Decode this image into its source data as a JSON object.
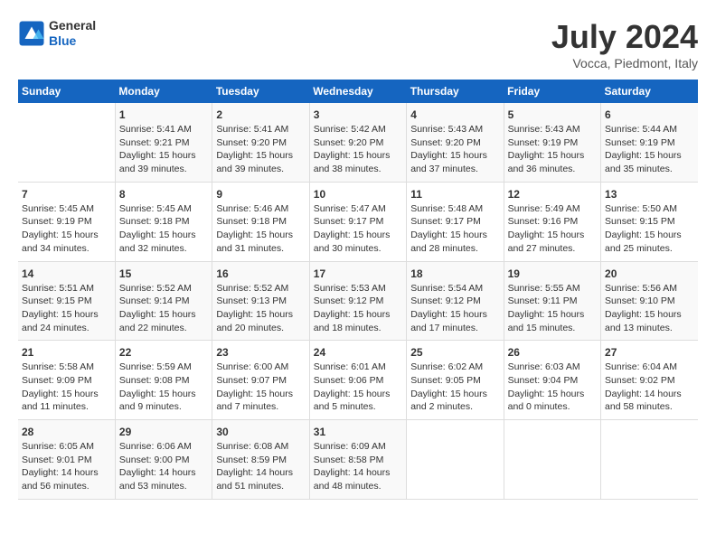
{
  "header": {
    "logo_general": "General",
    "logo_blue": "Blue",
    "month_year": "July 2024",
    "location": "Vocca, Piedmont, Italy"
  },
  "columns": [
    "Sunday",
    "Monday",
    "Tuesday",
    "Wednesday",
    "Thursday",
    "Friday",
    "Saturday"
  ],
  "weeks": [
    [
      {
        "day": "",
        "info": ""
      },
      {
        "day": "1",
        "info": "Sunrise: 5:41 AM\nSunset: 9:21 PM\nDaylight: 15 hours\nand 39 minutes."
      },
      {
        "day": "2",
        "info": "Sunrise: 5:41 AM\nSunset: 9:20 PM\nDaylight: 15 hours\nand 39 minutes."
      },
      {
        "day": "3",
        "info": "Sunrise: 5:42 AM\nSunset: 9:20 PM\nDaylight: 15 hours\nand 38 minutes."
      },
      {
        "day": "4",
        "info": "Sunrise: 5:43 AM\nSunset: 9:20 PM\nDaylight: 15 hours\nand 37 minutes."
      },
      {
        "day": "5",
        "info": "Sunrise: 5:43 AM\nSunset: 9:19 PM\nDaylight: 15 hours\nand 36 minutes."
      },
      {
        "day": "6",
        "info": "Sunrise: 5:44 AM\nSunset: 9:19 PM\nDaylight: 15 hours\nand 35 minutes."
      }
    ],
    [
      {
        "day": "7",
        "info": "Sunrise: 5:45 AM\nSunset: 9:19 PM\nDaylight: 15 hours\nand 34 minutes."
      },
      {
        "day": "8",
        "info": "Sunrise: 5:45 AM\nSunset: 9:18 PM\nDaylight: 15 hours\nand 32 minutes."
      },
      {
        "day": "9",
        "info": "Sunrise: 5:46 AM\nSunset: 9:18 PM\nDaylight: 15 hours\nand 31 minutes."
      },
      {
        "day": "10",
        "info": "Sunrise: 5:47 AM\nSunset: 9:17 PM\nDaylight: 15 hours\nand 30 minutes."
      },
      {
        "day": "11",
        "info": "Sunrise: 5:48 AM\nSunset: 9:17 PM\nDaylight: 15 hours\nand 28 minutes."
      },
      {
        "day": "12",
        "info": "Sunrise: 5:49 AM\nSunset: 9:16 PM\nDaylight: 15 hours\nand 27 minutes."
      },
      {
        "day": "13",
        "info": "Sunrise: 5:50 AM\nSunset: 9:15 PM\nDaylight: 15 hours\nand 25 minutes."
      }
    ],
    [
      {
        "day": "14",
        "info": "Sunrise: 5:51 AM\nSunset: 9:15 PM\nDaylight: 15 hours\nand 24 minutes."
      },
      {
        "day": "15",
        "info": "Sunrise: 5:52 AM\nSunset: 9:14 PM\nDaylight: 15 hours\nand 22 minutes."
      },
      {
        "day": "16",
        "info": "Sunrise: 5:52 AM\nSunset: 9:13 PM\nDaylight: 15 hours\nand 20 minutes."
      },
      {
        "day": "17",
        "info": "Sunrise: 5:53 AM\nSunset: 9:12 PM\nDaylight: 15 hours\nand 18 minutes."
      },
      {
        "day": "18",
        "info": "Sunrise: 5:54 AM\nSunset: 9:12 PM\nDaylight: 15 hours\nand 17 minutes."
      },
      {
        "day": "19",
        "info": "Sunrise: 5:55 AM\nSunset: 9:11 PM\nDaylight: 15 hours\nand 15 minutes."
      },
      {
        "day": "20",
        "info": "Sunrise: 5:56 AM\nSunset: 9:10 PM\nDaylight: 15 hours\nand 13 minutes."
      }
    ],
    [
      {
        "day": "21",
        "info": "Sunrise: 5:58 AM\nSunset: 9:09 PM\nDaylight: 15 hours\nand 11 minutes."
      },
      {
        "day": "22",
        "info": "Sunrise: 5:59 AM\nSunset: 9:08 PM\nDaylight: 15 hours\nand 9 minutes."
      },
      {
        "day": "23",
        "info": "Sunrise: 6:00 AM\nSunset: 9:07 PM\nDaylight: 15 hours\nand 7 minutes."
      },
      {
        "day": "24",
        "info": "Sunrise: 6:01 AM\nSunset: 9:06 PM\nDaylight: 15 hours\nand 5 minutes."
      },
      {
        "day": "25",
        "info": "Sunrise: 6:02 AM\nSunset: 9:05 PM\nDaylight: 15 hours\nand 2 minutes."
      },
      {
        "day": "26",
        "info": "Sunrise: 6:03 AM\nSunset: 9:04 PM\nDaylight: 15 hours\nand 0 minutes."
      },
      {
        "day": "27",
        "info": "Sunrise: 6:04 AM\nSunset: 9:02 PM\nDaylight: 14 hours\nand 58 minutes."
      }
    ],
    [
      {
        "day": "28",
        "info": "Sunrise: 6:05 AM\nSunset: 9:01 PM\nDaylight: 14 hours\nand 56 minutes."
      },
      {
        "day": "29",
        "info": "Sunrise: 6:06 AM\nSunset: 9:00 PM\nDaylight: 14 hours\nand 53 minutes."
      },
      {
        "day": "30",
        "info": "Sunrise: 6:08 AM\nSunset: 8:59 PM\nDaylight: 14 hours\nand 51 minutes."
      },
      {
        "day": "31",
        "info": "Sunrise: 6:09 AM\nSunset: 8:58 PM\nDaylight: 14 hours\nand 48 minutes."
      },
      {
        "day": "",
        "info": ""
      },
      {
        "day": "",
        "info": ""
      },
      {
        "day": "",
        "info": ""
      }
    ]
  ]
}
